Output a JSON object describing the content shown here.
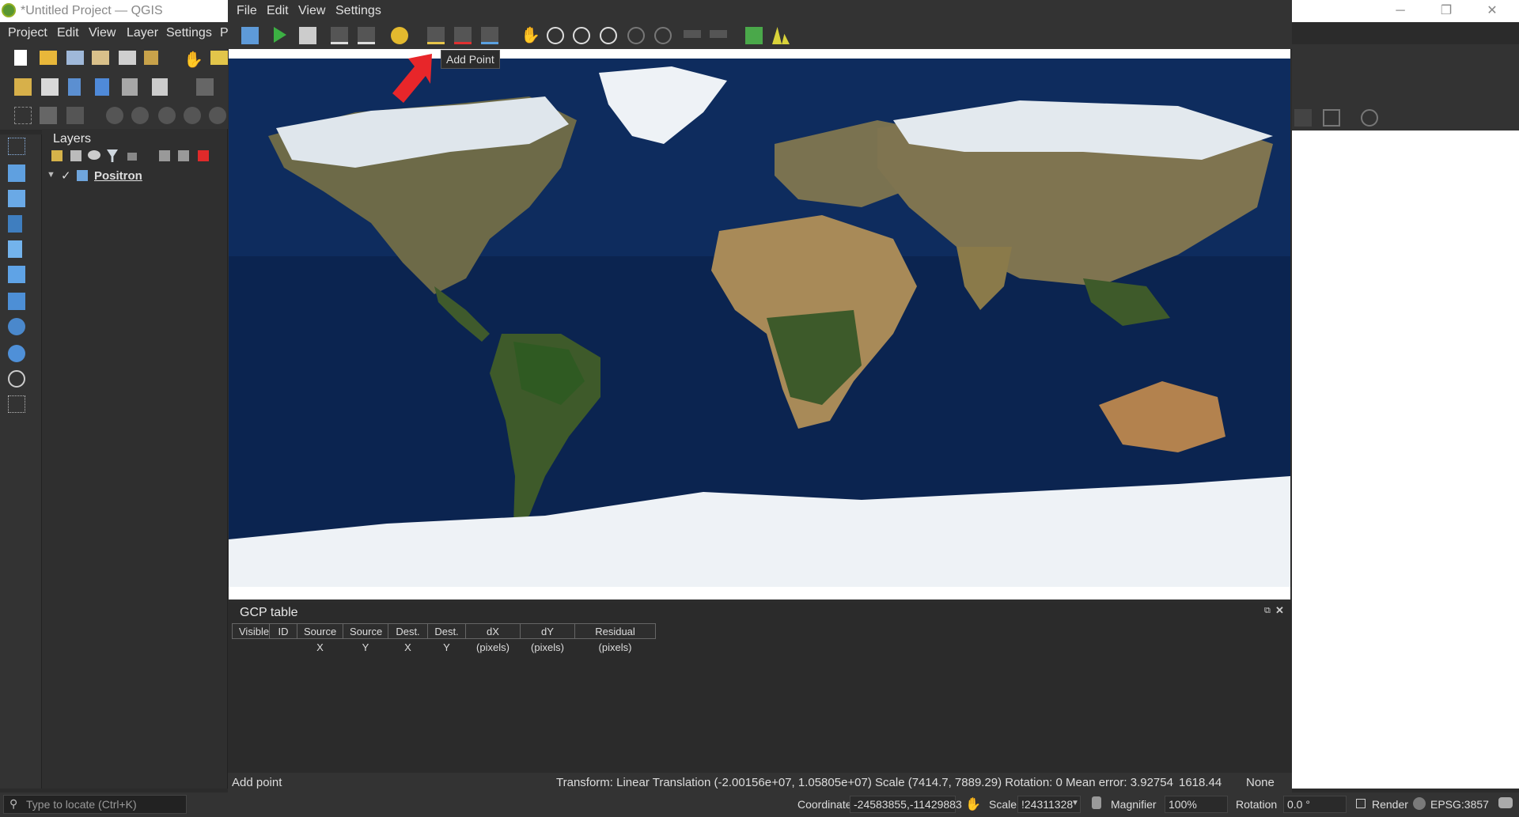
{
  "qgis": {
    "window_title": "*Untitled Project — QGIS",
    "menu": [
      "Project",
      "Edit",
      "View",
      "Layer",
      "Settings",
      "P"
    ],
    "layers_panel": {
      "title": "Layers",
      "layers": [
        {
          "name": "Positron",
          "checked": true
        }
      ]
    },
    "locator_placeholder": "Type to locate (Ctrl+K)",
    "status": {
      "coordinate_label": "Coordinate",
      "coordinate_value": "-24583855,-11429883",
      "scale_label": "Scale",
      "scale_value": "!24311328",
      "magnifier_label": "Magnifier",
      "magnifier_value": "100%",
      "rotation_label": "Rotation",
      "rotation_value": "0.0 °",
      "render_label": "Render",
      "crs": "EPSG:3857"
    }
  },
  "georeferencer": {
    "menu": [
      "File",
      "Edit",
      "View",
      "Settings"
    ],
    "tooltip": "Add Point",
    "gcp_table": {
      "title": "GCP table",
      "columns": [
        "Visible",
        "ID",
        "Source X",
        "Source Y",
        "Dest. X",
        "Dest. Y",
        "dX (pixels)",
        "dY (pixels)",
        "Residual (pixels)"
      ]
    },
    "status": {
      "mode": "Add point",
      "transform": "Transform: Linear Translation (-2.00156e+07, 1.05805e+07) Scale (7414.7, 7889.29) Rotation: 0 Mean error: 3.92754",
      "value": "1618.44",
      "crs": "None"
    }
  },
  "colors": {
    "arrow": "#e8262a",
    "ocean": "#0d2a55",
    "ice": "#eef2f6",
    "land": "#7a6a40"
  }
}
